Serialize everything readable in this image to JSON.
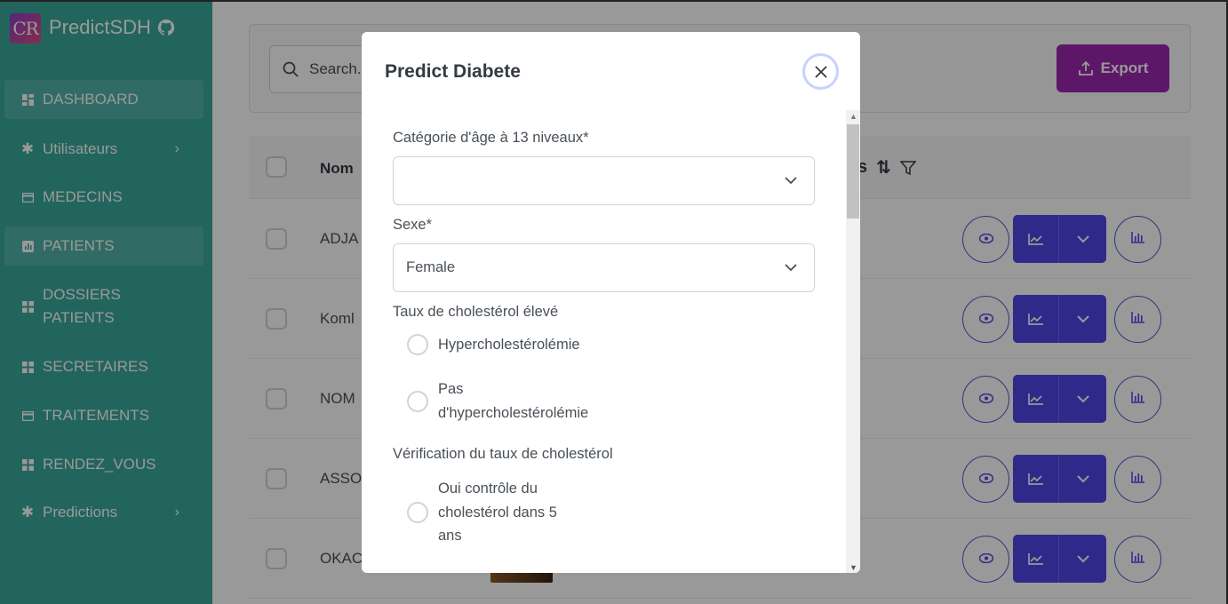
{
  "brand": {
    "logo_text": "CR",
    "name": "PredictSDH"
  },
  "sidebar": {
    "items": [
      {
        "label": "DASHBOARD",
        "icon": "dashboard-icon",
        "active": true
      },
      {
        "label": "Utilisateurs",
        "icon": "puzzle-icon",
        "has_submenu": true
      },
      {
        "label": "MEDECINS",
        "icon": "card-icon"
      },
      {
        "label": "PATIENTS",
        "icon": "chart-square-icon",
        "active": true
      },
      {
        "label": "DOSSIERS PATIENTS",
        "icon": "grid-icon"
      },
      {
        "label": "SECRETAIRES",
        "icon": "grid-icon"
      },
      {
        "label": "TRAITEMENTS",
        "icon": "card-icon"
      },
      {
        "label": "RENDEZ_VOUS",
        "icon": "grid-icon"
      },
      {
        "label": "Predictions",
        "icon": "puzzle-icon",
        "has_submenu": true
      }
    ]
  },
  "toolbar": {
    "search_placeholder": "Search...",
    "export_label": "Export"
  },
  "table": {
    "header_name": "Nom",
    "header_partial": "s",
    "rows": [
      {
        "name": "ADJA"
      },
      {
        "name": "Koml"
      },
      {
        "name": "NOM"
      },
      {
        "name": "ASSO"
      },
      {
        "name": "OKAC"
      }
    ]
  },
  "modal": {
    "title": "Predict Diabete",
    "fields": {
      "age_label": "Catégorie d'âge à 13 niveaux*",
      "age_value": "",
      "sex_label": "Sexe*",
      "sex_value": "Female",
      "chol_label": "Taux de cholestérol élevé",
      "chol_opt1": "Hypercholestérolémie",
      "chol_opt2": "Pas d'hypercholestérolémie",
      "check_label": "Vérification du taux de cholestérol",
      "check_opt1": "Oui contrôle du cholestérol dans 5 ans"
    }
  },
  "colors": {
    "sidebar": "#3aa89b",
    "export": "#9c27b0",
    "action": "#4f46e5"
  }
}
